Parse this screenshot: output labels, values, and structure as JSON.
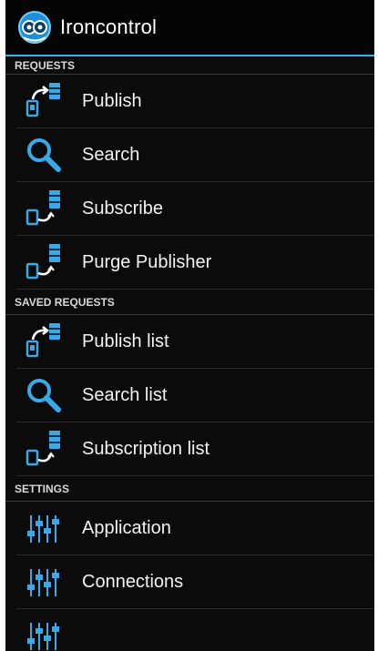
{
  "app": {
    "title": "Ironcontrol",
    "icon": "ironcontrol-logo-icon"
  },
  "sections": [
    {
      "header": "REQUESTS",
      "items": [
        {
          "label": "Publish",
          "icon": "publish-icon"
        },
        {
          "label": "Search",
          "icon": "search-icon"
        },
        {
          "label": "Subscribe",
          "icon": "subscribe-icon"
        },
        {
          "label": "Purge Publisher",
          "icon": "purge-publisher-icon"
        }
      ]
    },
    {
      "header": "SAVED REQUESTS",
      "items": [
        {
          "label": "Publish list",
          "icon": "publish-icon"
        },
        {
          "label": "Search list",
          "icon": "search-icon"
        },
        {
          "label": "Subscription list",
          "icon": "subscribe-icon"
        }
      ]
    },
    {
      "header": "SETTINGS",
      "items": [
        {
          "label": "Application",
          "icon": "settings-sliders-icon"
        },
        {
          "label": "Connections",
          "icon": "settings-sliders-icon"
        }
      ]
    }
  ],
  "colors": {
    "accent": "#33b5e5",
    "background": "#0b0b0b",
    "icon_blue": "#3aa9e8"
  }
}
